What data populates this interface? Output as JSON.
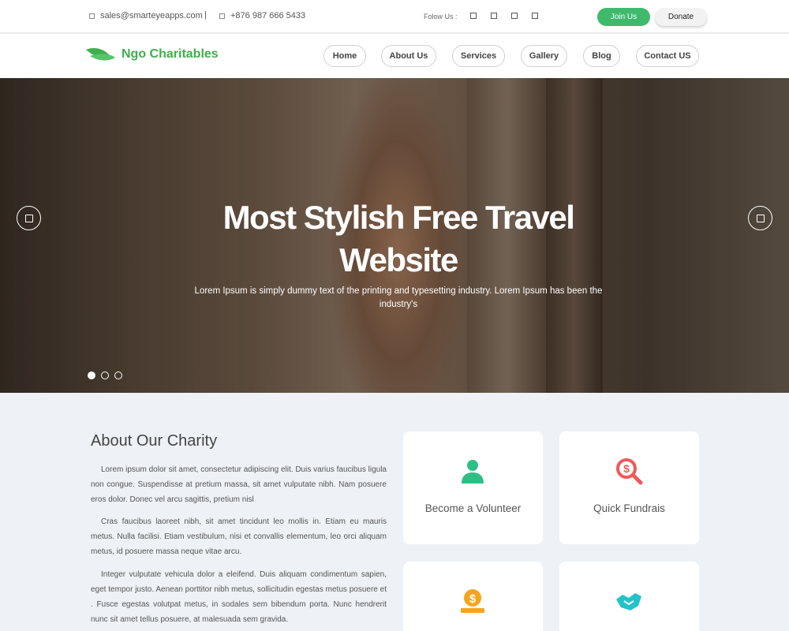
{
  "topbar": {
    "email": "sales@smarteyeapps.com",
    "separator": "|",
    "phone": "+876 987 666 5433",
    "follow_label": "Folow Us :",
    "social_icons": [
      "facebook-icon",
      "twitter-icon",
      "instagram-icon",
      "linkedin-icon"
    ],
    "join_label": "Join Us",
    "donate_label": "Donate"
  },
  "brand": {
    "name": "Ngo Charitables",
    "color": "#3fae4c"
  },
  "nav": {
    "items": [
      "Home",
      "About Us",
      "Services",
      "Gallery",
      "Blog",
      "Contact US"
    ]
  },
  "hero": {
    "title_line1": "Most Stylish Free Travel",
    "title_line2": "Website",
    "subtitle": "Lorem Ipsum is simply dummy text of the printing and typesetting industry. Lorem Ipsum has been the industry's",
    "slides": 3,
    "active_slide": 1
  },
  "about": {
    "title": "About Our Charity",
    "paragraphs": [
      "Lorem ipsum dolor sit amet, consectetur adipiscing elit. Duis varius faucibus ligula non congue. Suspendisse at pretium massa, sit amet vulputate nibh. Nam posuere eros dolor. Donec vel arcu sagittis, pretium nisl",
      "Cras faucibus laoreet nibh, sit amet tincidunt leo mollis in. Etiam eu mauris metus. Nulla facilisi. Etiam vestibulum, nisi et convallis elementum, leo orci aliquam metus, id posuere massa neque vitae arcu.",
      "Integer vulputate vehicula dolor a eleifend. Duis aliquam condimentum sapien, eget tempor justo. Aenean porttitor nibh metus, sollicitudin egestas metus posuere et . Fusce egestas volutpat metus, in sodales sem bibendum porta. Nunc hendrerit nunc sit amet tellus posuere, at malesuada sem gravida."
    ]
  },
  "cards": [
    {
      "label": "Become a Volunteer",
      "icon": "volunteer-icon",
      "color": "#2fbf86"
    },
    {
      "label": "Quick Fundrais",
      "icon": "fundraise-search-icon",
      "color": "#ef5a5a"
    },
    {
      "label": "",
      "icon": "donation-coin-icon",
      "color": "#f4a51c"
    },
    {
      "label": "",
      "icon": "handshake-icon",
      "color": "#22c3c9"
    }
  ],
  "colors": {
    "accent": "#3fba6c",
    "page_bg": "#eef1f5"
  }
}
